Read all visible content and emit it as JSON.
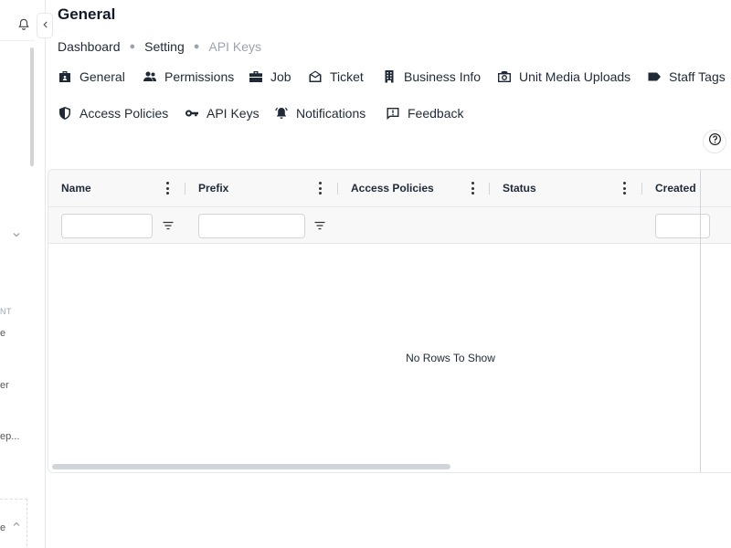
{
  "sidebar": {
    "section_label": "NT",
    "item_fragments": [
      "e",
      "er",
      "ep..."
    ],
    "bottom_fragment": "e"
  },
  "page": {
    "title": "General"
  },
  "breadcrumb": {
    "items": [
      "Dashboard",
      "Setting",
      "API Keys"
    ]
  },
  "tabs": [
    {
      "label": "General",
      "icon": "briefcase-badge-icon"
    },
    {
      "label": "Permissions",
      "icon": "users-icon"
    },
    {
      "label": "Job",
      "icon": "briefcase-icon"
    },
    {
      "label": "Ticket",
      "icon": "envelope-open-icon"
    },
    {
      "label": "Business Info",
      "icon": "building-icon"
    },
    {
      "label": "Unit Media Uploads",
      "icon": "camera-icon"
    },
    {
      "label": "Staff Tags",
      "icon": "tag-icon"
    },
    {
      "label": "Access Policies",
      "icon": "shield-icon"
    },
    {
      "label": "API Keys",
      "icon": "key-icon"
    },
    {
      "label": "Notifications",
      "icon": "bell-ring-icon"
    },
    {
      "label": "Feedback",
      "icon": "message-alert-icon"
    }
  ],
  "grid": {
    "columns": [
      "Name",
      "Prefix",
      "Access Policies",
      "Status",
      "Created"
    ],
    "empty_message": "No Rows To Show"
  }
}
